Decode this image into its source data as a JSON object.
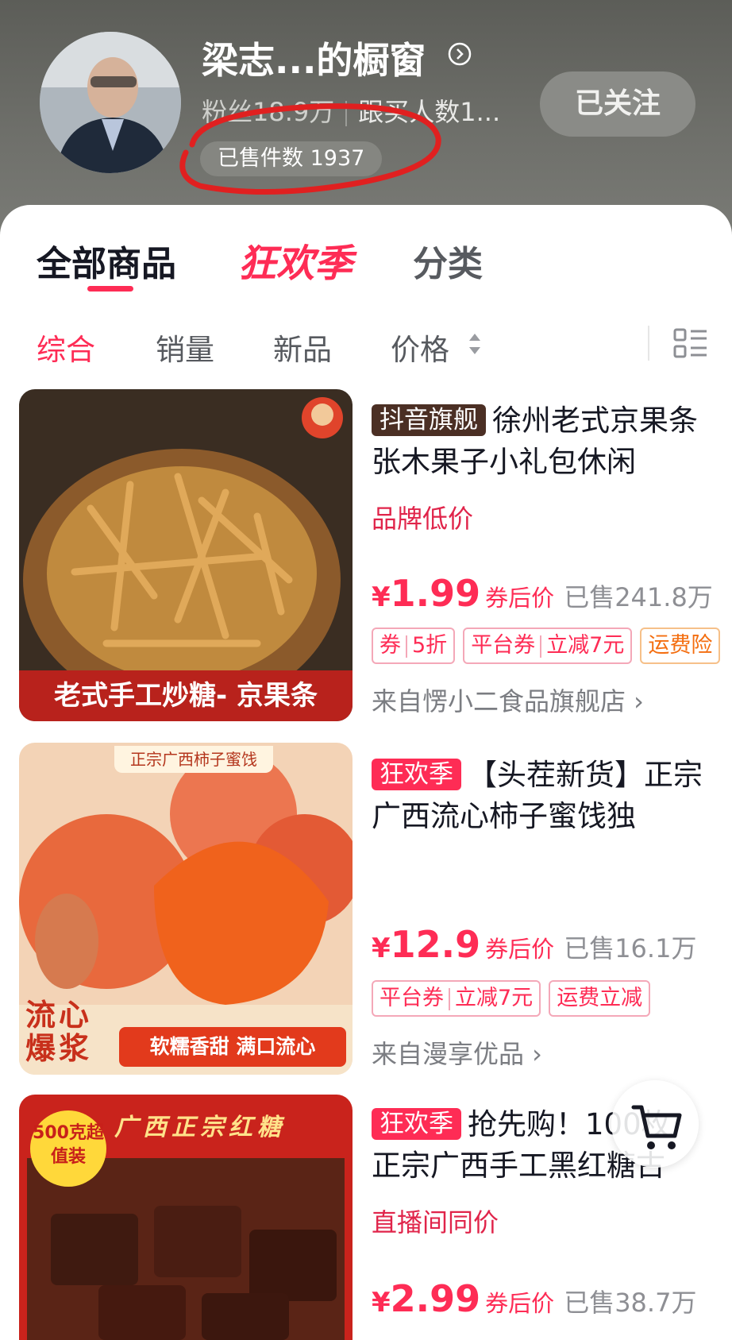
{
  "header": {
    "shop_name": "梁志...的橱窗",
    "fans": "粉丝18.9万",
    "followers_buy": "跟买人数1...",
    "sold_count": "已售件数 1937",
    "follow_label": "已关注"
  },
  "tabs": [
    "全部商品",
    "狂欢季",
    "分类"
  ],
  "sort": [
    "综合",
    "销量",
    "新品",
    "价格"
  ],
  "products": [
    {
      "badge": "抖音旗舰",
      "title": "徐州老式京果条张木果子小礼包休闲",
      "subline": "品牌低价",
      "currency": "¥",
      "price": "1.99",
      "price_label": "券后价",
      "sold": "已售241.8万",
      "tag1_a": "券",
      "tag1_b": "5折",
      "tag2_a": "平台券",
      "tag2_b": "立减7元",
      "tag3": "运费险",
      "shop": "来自愣小二食品旗舰店 ›",
      "image_caption": "老式手工炒糖- 京果条"
    },
    {
      "badge": "狂欢季",
      "title": "【头茬新货】正宗广西流心柿子蜜饯独",
      "currency": "¥",
      "price": "12.9",
      "price_label": "券后价",
      "sold": "已售16.1万",
      "tag1_a": "平台券",
      "tag1_b": "立减7元",
      "tag2": "运费立减",
      "shop": "来自漫享优品 ›",
      "image_top": "正宗广西柿子蜜饯",
      "image_caption": "软糯香甜  满口流心",
      "image_side": "流心爆浆"
    },
    {
      "badge": "狂欢季",
      "title": "抢先购！100枚 正宗广西手工黑红糖古",
      "subline": "直播间同价",
      "currency": "¥",
      "price": "2.99",
      "price_label": "券后价",
      "sold": "已售38.7万",
      "image_top": "广西正宗红糖",
      "image_stamp": "500克超值装"
    }
  ],
  "icons": [
    "chevron-right-icon",
    "sort-arrows-icon",
    "list-view-icon",
    "cart-icon"
  ],
  "colors": {
    "accent": "#fe2c55",
    "header_bg": "#6e6f6a"
  }
}
